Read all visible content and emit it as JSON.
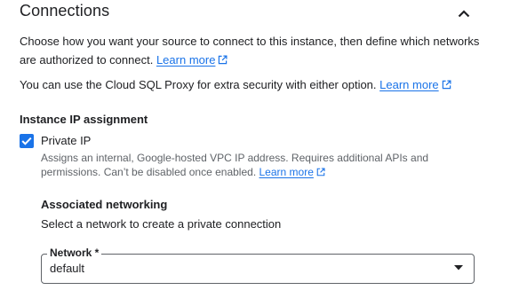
{
  "section": {
    "title": "Connections",
    "collapse_icon": "chevron-up-icon"
  },
  "intro": {
    "text": "Choose how you want your source to connect to this instance, then define which networks are authorized to connect.",
    "link": "Learn more"
  },
  "proxy": {
    "text": "You can use the Cloud SQL Proxy for extra security with either option.",
    "link": "Learn more"
  },
  "ip_assignment": {
    "heading": "Instance IP assignment",
    "private_ip": {
      "label": "Private IP",
      "checked": true,
      "helper": "Assigns an internal, Google-hosted VPC IP address. Requires additional APIs and permissions. Can’t be disabled once enabled.",
      "link": "Learn more"
    }
  },
  "associated_networking": {
    "heading": "Associated networking",
    "description": "Select a network to create a private connection",
    "network_select": {
      "label": "Network *",
      "value": "default"
    }
  },
  "colors": {
    "accent": "#1a73e8",
    "text": "#202124",
    "secondary_text": "#5f6368"
  }
}
